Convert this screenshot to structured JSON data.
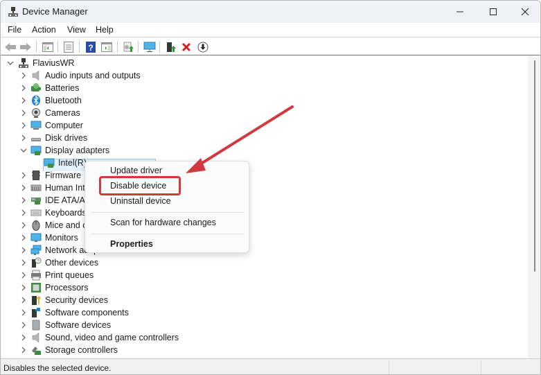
{
  "window": {
    "title": "Device Manager",
    "controls": {
      "minimize": "minimize",
      "maximize": "maximize",
      "close": "close"
    }
  },
  "menu": [
    "File",
    "Action",
    "View",
    "Help"
  ],
  "toolbar": [
    {
      "icon": "back-arrow-icon"
    },
    {
      "icon": "forward-arrow-icon"
    },
    {
      "icon": "show-hide-console-tree-icon"
    },
    {
      "icon": "properties-icon"
    },
    {
      "icon": "help-icon"
    },
    {
      "icon": "show-hide-action-pane-icon"
    },
    {
      "icon": "update-driver-icon"
    },
    {
      "icon": "scan-hardware-icon"
    },
    {
      "icon": "enable-device-icon"
    },
    {
      "icon": "uninstall-device-icon"
    },
    {
      "icon": "disable-device-icon"
    }
  ],
  "tree": {
    "root": "FlaviusWR",
    "categories": [
      {
        "label": "Audio inputs and outputs",
        "icon": "speaker-icon"
      },
      {
        "label": "Batteries",
        "icon": "battery-icon"
      },
      {
        "label": "Bluetooth",
        "icon": "bluetooth-icon"
      },
      {
        "label": "Cameras",
        "icon": "camera-icon"
      },
      {
        "label": "Computer",
        "icon": "computer-icon"
      },
      {
        "label": "Disk drives",
        "icon": "disk-drive-icon"
      },
      {
        "label": "Display adapters",
        "icon": "display-adapter-icon",
        "expanded": true
      },
      {
        "label": "Firmware",
        "icon": "firmware-icon"
      },
      {
        "label": "Human Int",
        "icon": "hid-icon"
      },
      {
        "label": "IDE ATA/AT",
        "icon": "ide-controller-icon"
      },
      {
        "label": "Keyboards",
        "icon": "keyboard-icon"
      },
      {
        "label": "Mice and o",
        "icon": "mouse-icon"
      },
      {
        "label": "Monitors",
        "icon": "monitor-icon"
      },
      {
        "label": "Network adapters",
        "icon": "network-adapter-icon"
      },
      {
        "label": "Other devices",
        "icon": "other-devices-icon"
      },
      {
        "label": "Print queues",
        "icon": "printer-icon"
      },
      {
        "label": "Processors",
        "icon": "processor-icon"
      },
      {
        "label": "Security devices",
        "icon": "security-device-icon"
      },
      {
        "label": "Software components",
        "icon": "software-component-icon"
      },
      {
        "label": "Software devices",
        "icon": "software-device-icon"
      },
      {
        "label": "Sound, video and game controllers",
        "icon": "sound-icon"
      },
      {
        "label": "Storage controllers",
        "icon": "storage-controller-icon"
      }
    ],
    "selected_child": "Intel(R)"
  },
  "context_menu": {
    "items": [
      "Update driver",
      "Disable device",
      "Uninstall device",
      "Scan for hardware changes",
      "Properties"
    ],
    "highlighted": "Disable device"
  },
  "status": {
    "message": "Disables the selected device."
  },
  "colors": {
    "annotation_red": "#d1393f",
    "selection_bg": "#e5f1fb"
  }
}
